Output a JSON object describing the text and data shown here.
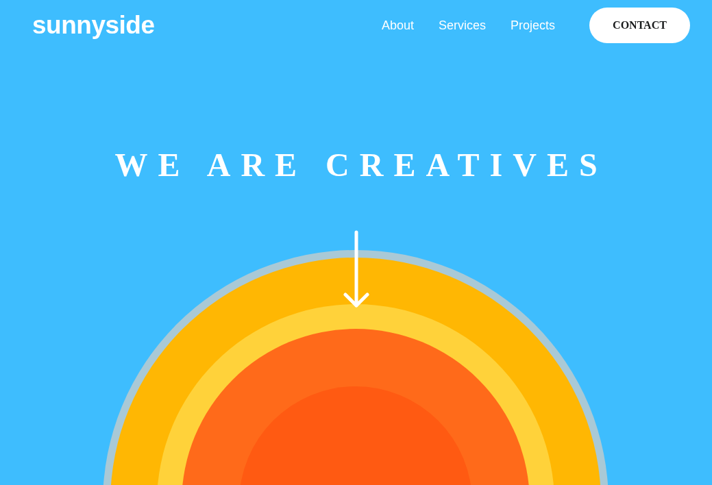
{
  "logo": "sunnyside",
  "nav": {
    "links": [
      "About",
      "Services",
      "Projects"
    ],
    "contact": "CONTACT"
  },
  "hero": {
    "headline": "WE ARE CREATIVES"
  }
}
